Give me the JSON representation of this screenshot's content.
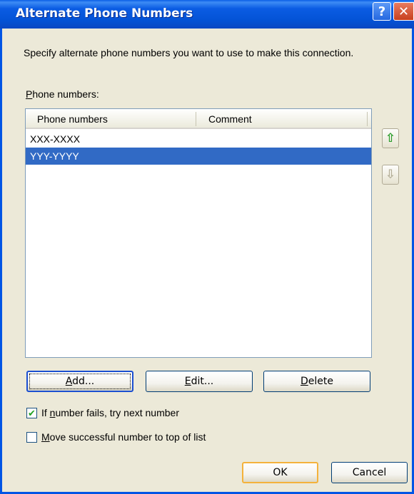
{
  "window": {
    "title": "Alternate Phone Numbers",
    "help_glyph": "?",
    "close_glyph": "✕"
  },
  "description": "Specify alternate phone numbers you want to use to make this connection.",
  "list": {
    "label": "Phone numbers:",
    "columns": [
      "Phone numbers",
      "Comment"
    ],
    "rows": [
      {
        "number": "XXX-XXXX",
        "comment": "",
        "selected": false
      },
      {
        "number": "YYY-YYYY",
        "comment": "",
        "selected": true
      }
    ]
  },
  "side_buttons": {
    "up_icon": "arrow-up-icon",
    "down_icon": "arrow-down-icon",
    "up_glyph": "⇧",
    "down_glyph": "⇩"
  },
  "actions": {
    "add": "Add...",
    "edit": "Edit...",
    "delete": "Delete"
  },
  "options": {
    "try_next": {
      "label": "If number fails, try next number",
      "checked": true
    },
    "move_top": {
      "label": "Move successful number to top of list",
      "checked": false
    }
  },
  "footer": {
    "ok": "OK",
    "cancel": "Cancel"
  },
  "colors": {
    "title_bar": "#0055e5",
    "selection": "#316ac5",
    "check": "#21a121"
  }
}
